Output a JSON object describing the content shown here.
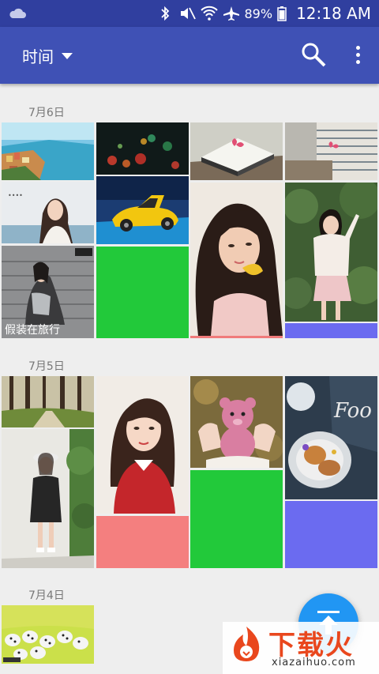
{
  "status_bar": {
    "battery": "89%",
    "time": "12:18 AM"
  },
  "app_bar": {
    "title": "时间"
  },
  "sections": [
    {
      "date": "7月6日"
    },
    {
      "date": "7月5日"
    },
    {
      "date": "7月4日"
    }
  ],
  "photos": {
    "coast_village": "coastal town photo",
    "night_bokeh": "bokeh lights photo",
    "book_heart": "book with heart photo",
    "book_stack": "stacked books photo",
    "girl_poster_1": "girl portrait poster",
    "yellow_car": "yellow sports car photo",
    "girl_leaf": "girl with leaf photo",
    "girl_garden": "girl in garden photo",
    "girl_stairs": "girl on stairs photo",
    "green_block": "#22c93a",
    "pink_strip": "#f07b7b",
    "purple_strip": "#6b6bf0",
    "forest": "forest photo",
    "girl_red_dress": "girl in red dress photo",
    "teddy_bear": "pink teddy bear photo",
    "food_plate": "food plate photo",
    "little_girl": "little girl photo",
    "pink_block": "#f47f7f",
    "green_block_2": "#22c93a",
    "purple_block": "#6b6bf0",
    "dalmatians": "dalmatian puppies photo"
  },
  "poster_text": {
    "girl_stairs_caption": "假装在旅行"
  },
  "colors": {
    "primary": "#3f51b5",
    "primary_dark": "#303f9f",
    "accent": "#2196f3"
  },
  "watermark": {
    "text": "下载火",
    "url": "xiazaihuo.com"
  }
}
